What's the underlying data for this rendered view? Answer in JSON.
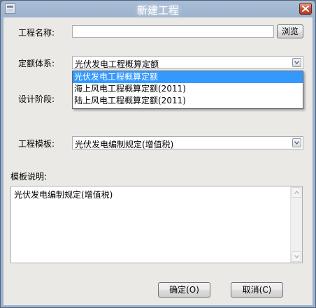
{
  "window": {
    "title": "新建工程"
  },
  "form": {
    "project_name": {
      "label": "工程名称:",
      "value": "",
      "browse_label": "浏览"
    },
    "quota_system": {
      "label": "定额体系:",
      "value": "光伏发电工程概算定额",
      "options": [
        "光伏发电工程概算定额",
        "海上风电工程概算定额(2011)",
        "陆上风电工程概算定额(2011)"
      ],
      "highlighted_index": 0
    },
    "design_stage": {
      "label": "设计阶段:"
    },
    "template": {
      "label": "工程模板:",
      "value": "光伏发电编制规定(增值税)"
    },
    "template_desc": {
      "label": "模板说明:",
      "value": "光伏发电编制规定(增值税)"
    }
  },
  "buttons": {
    "ok_label": "确定(O)",
    "cancel_label": "取消(C)"
  },
  "icons": {
    "app": "app-icon",
    "close": "close-icon",
    "dropdown": "chevron-down-icon",
    "scroll_up": "scroll-up-icon",
    "scroll_down": "scroll-down-icon"
  },
  "colors": {
    "selection": "#3399ff",
    "close_button": "#c8523a"
  }
}
